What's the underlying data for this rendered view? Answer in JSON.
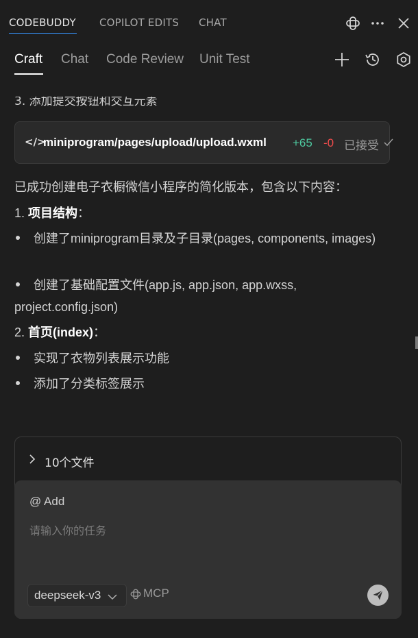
{
  "panel_tabs": [
    {
      "label": "CODEBUDDY",
      "active": true
    },
    {
      "label": "COPILOT EDITS",
      "active": false
    },
    {
      "label": "CHAT",
      "active": false
    }
  ],
  "mode_tabs": [
    {
      "label": "Craft",
      "active": true
    },
    {
      "label": "Chat",
      "active": false
    },
    {
      "label": "Code Review",
      "active": false
    },
    {
      "label": "Unit Test",
      "active": false
    }
  ],
  "conversation": {
    "partial_line": "3. 添加提交按钮和交互元素",
    "file_card": {
      "path": "miniprogram/pages/upload/upload.wxml",
      "additions": "+65",
      "deletions": "-0",
      "status": "已接受"
    },
    "summary": "已成功创建电子衣橱微信小程序的简化版本，包含以下内容：",
    "section1_num": "1.",
    "section1_title": "项目结构",
    "section1_colon": "：",
    "section1_item1": "创建了miniprogram目录及子目录(pages, components, images)",
    "section1_item2": "创建了基础配置文件(app.js, app.json, app.wxss, project.config.json)",
    "section2_num": "2.",
    "section2_title": "首页(index)",
    "section2_colon": "：",
    "section2_item1": "实现了衣物列表展示功能",
    "section2_item2": "添加了分类标签展示"
  },
  "files": {
    "label": "10个文件"
  },
  "input": {
    "add_label": "@ Add",
    "placeholder": "请输入你的任务",
    "model": "deepseek-v3",
    "mcp_label": "MCP"
  },
  "colors": {
    "accent": "#3794ff",
    "additions": "#4ec9a0",
    "deletions": "#f14c4c",
    "background": "#1e1e1e"
  },
  "icons": [
    "codebuddy-icon",
    "more-icon",
    "close-icon",
    "plus-icon",
    "history-icon",
    "settings-icon",
    "code-icon",
    "check-icon",
    "chevron-right-icon",
    "chevron-down-icon",
    "mcp-icon",
    "send-icon"
  ]
}
